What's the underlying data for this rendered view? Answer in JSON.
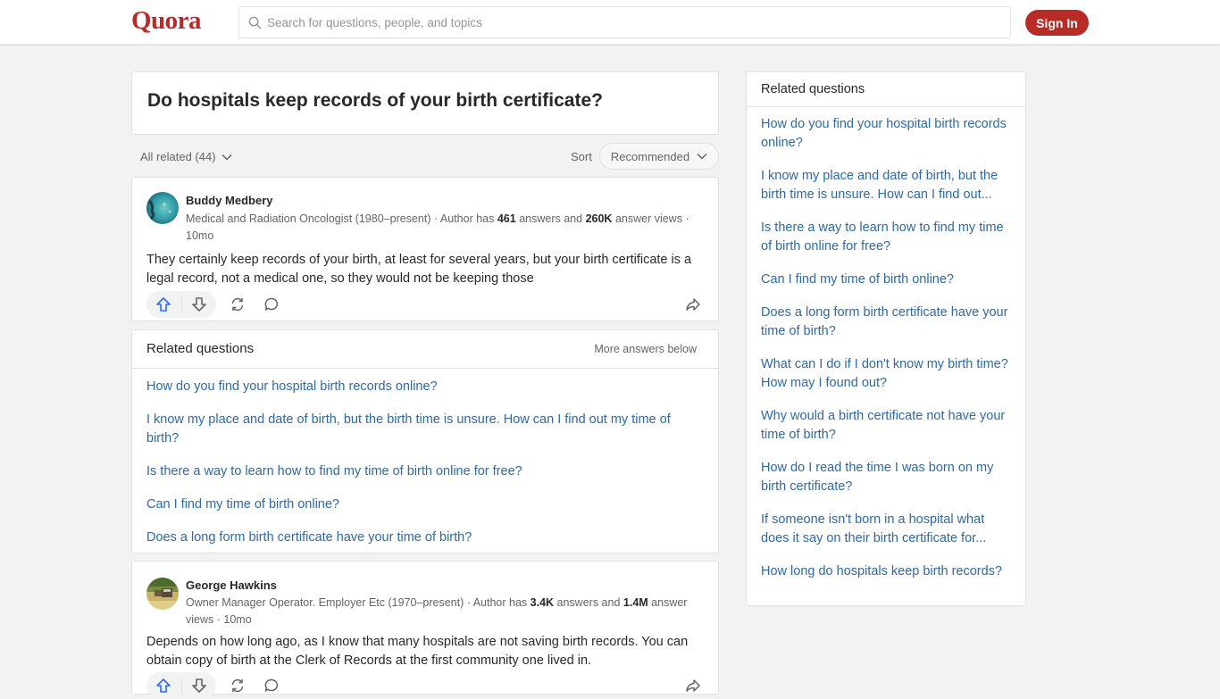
{
  "header": {
    "logo": "Quora",
    "search_placeholder": "Search for questions, people, and topics",
    "sign_in_label": "Sign In",
    "brand_color": "#b92b27"
  },
  "question": {
    "title": "Do hospitals keep records of your birth certificate?"
  },
  "filters": {
    "all_related_label": "All related (44)",
    "sort_label": "Sort",
    "sort_value": "Recommended"
  },
  "answers": [
    {
      "author": "Buddy Medbery",
      "credential": "Medical and Radiation Oncologist (1980–present)",
      "author_has": "Author has",
      "answers_count": "461",
      "answers_word": "answers and",
      "views_count": "260K",
      "views_word": "answer views",
      "age": "10mo",
      "text": "They certainly keep records of your birth, at least for several years, but your birth certificate is a legal record, not a medical one, so they would not be keeping those"
    },
    {
      "author": "George Hawkins",
      "credential": "Owner Manager Operator. Employer Etc (1970–present)",
      "author_has": "Author has",
      "answers_count": "3.4K",
      "answers_word": "answers and",
      "views_count": "1.4M",
      "views_word": "answer views",
      "age": "10mo",
      "text": "Depends on how long ago, as I know that many hospitals are not saving birth records. You can obtain copy of birth at the Clerk of Records at the first community one lived in."
    }
  ],
  "related_mid": {
    "title": "Related questions",
    "more_label": "More answers below",
    "items": [
      "How do you find your hospital birth records online?",
      "I know my place and date of birth, but the birth time is unsure. How can I find out my time of birth?",
      "Is there a way to learn how to find my time of birth online for free?",
      "Can I find my time of birth online?",
      "Does a long form birth certificate have your time of birth?"
    ]
  },
  "related_side": {
    "title": "Related questions",
    "items": [
      "How do you find your hospital birth records online?",
      "I know my place and date of birth, but the birth time is unsure. How can I find out...",
      "Is there a way to learn how to find my time of birth online for free?",
      "Can I find my time of birth online?",
      "Does a long form birth certificate have your time of birth?",
      "What can I do if I don't know my birth time? How may I found out?",
      "Why would a birth certificate not have your time of birth?",
      "How do I read the time I was born on my birth certificate?",
      "If someone isn't born in a hospital what does it say on their birth certificate for...",
      "How long do hospitals keep birth records?"
    ]
  },
  "icons": {
    "search": "search-icon",
    "chevron": "chevron-down-icon",
    "upvote": "upvote-icon",
    "downvote": "downvote-icon",
    "share_reshare": "reshare-icon",
    "comment": "comment-icon",
    "share": "share-icon"
  }
}
